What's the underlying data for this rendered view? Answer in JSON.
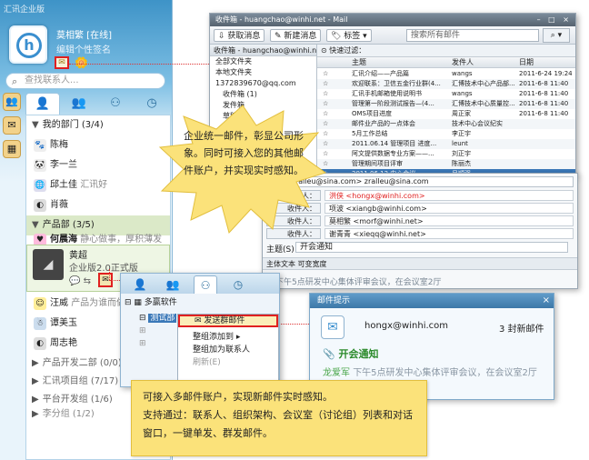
{
  "im": {
    "title": "汇讯企业版",
    "username": "莫相繁 [在线]",
    "signature": "编辑个性签名",
    "search_placeholder": "查找联系人...",
    "groups": [
      {
        "label": "我的部门 (3/4)"
      },
      {
        "label": "产品部 (3/5)"
      },
      {
        "label": "产品开发二部 (0/0)"
      },
      {
        "label": "汇讯项目组 (7/17)"
      },
      {
        "label": "平台开发组 (1/6)"
      },
      {
        "label": "李分组 (1/2)"
      }
    ],
    "contacts": [
      {
        "name": "陈梅",
        "sub": ""
      },
      {
        "name": "李一兰",
        "sub": ""
      },
      {
        "name": "邱土佳",
        "sub": "汇讯好"
      },
      {
        "name": "肖薇",
        "sub": ""
      },
      {
        "name": "何晨海",
        "sub": "静心做事，厚积薄发"
      },
      {
        "name": "汪威",
        "sub": "产品为谁而做"
      },
      {
        "name": "谭美玉",
        "sub": ""
      },
      {
        "name": "周志艳",
        "sub": ""
      }
    ],
    "selected": {
      "name": "黄超",
      "version": "企业版2.0正式版"
    }
  },
  "mail": {
    "title": "收件箱 - huangchao@winhi.net - Mail",
    "toolbar": {
      "receive": "获取消息",
      "compose": "新建消息",
      "tag": "标签"
    },
    "search_placeholder": "搜索所有邮件",
    "tree_header": "收件箱 - huangchao@winhi.net",
    "tree": [
      "全部文件夹",
      "本地文件夹",
      "1372839670@qq.com",
      "收件箱 (1)",
      "发件箱",
      "草稿"
    ],
    "filter": "快速过滤：",
    "cols": {
      "subject": "主题",
      "from": "发件人",
      "date": "日期"
    },
    "rows": [
      {
        "subject": "汇讯介绍——产品篇",
        "from": "wangs",
        "date": "2011-6-24 19:24"
      },
      {
        "subject": "欢迎联系：卫信五金行业群(4...",
        "from": "汇博技术中心产品部...",
        "date": "2011-6-8 11:40"
      },
      {
        "subject": "汇讯手机邮箱使用说明书",
        "from": "wangs",
        "date": "2011-6-8 11:40"
      },
      {
        "subject": "管理第一阶段测试报告—(4...",
        "from": "汇博技术中心质量控...",
        "date": "2011-6-8 11:40"
      },
      {
        "subject": "OMS项目进度",
        "from": "周正家",
        "date": "2011-6-8 11:40"
      },
      {
        "subject": "邮件业产品的一点体会",
        "from": "技术中心会议纪实",
        "date": ""
      },
      {
        "subject": "5月工作总结",
        "from": "李正宇",
        "date": ""
      },
      {
        "subject": "2011.06.14 管理项目 进度...",
        "from": "leunt",
        "date": ""
      },
      {
        "subject": "阿文提供数据专业方案——...",
        "from": "刘正宇",
        "date": ""
      },
      {
        "subject": "管理期间项目评审",
        "from": "陈丽杰",
        "date": ""
      },
      {
        "subject": "2011.06.13 中心会议",
        "from": "吕顺强",
        "date": ""
      },
      {
        "subject": "汇讯中心会议纪要",
        "from": "周工",
        "date": ""
      }
    ]
  },
  "compose": {
    "from": "<zralleu@sina.com> zralleu@sina.com",
    "recipient_label": "收件人：",
    "recipients": [
      {
        "name": "洪侠",
        "addr": "<hongx@winhi.com>"
      },
      {
        "name": "项波",
        "addr": "<xiangb@winhi.com>"
      },
      {
        "name": "莫相繁",
        "addr": "<morf@winhi.net>"
      },
      {
        "name": "谢青青",
        "addr": "<xieqq@winhi.net>"
      }
    ],
    "subject_label": "主题(S)：",
    "subject": "开会通知",
    "format_bar": "主体文本   可变宽度",
    "body": "下午5点研发中心集体评审会议，在会议室2厅"
  },
  "popup": {
    "tree_root": "多赢软件",
    "tree_child": "测试部",
    "menu": [
      "发送群邮件",
      "整组添加到",
      "整组加为联系人",
      "刷新(E)"
    ]
  },
  "notify": {
    "title": "邮件提示",
    "address": "hongx@winhi.com",
    "count": "3 封新邮件",
    "subject": "开会通知",
    "from": "龙爱军",
    "preview": "下午5点研发中心集体评审会议，在会议室2厅"
  },
  "callouts": {
    "burst": "企业统一邮件，彰显公司形象。同时可接入您的其他邮件账户，并实现实时感知。",
    "bottom_line1": "可接入多邮件账户，实现新邮件实时感知。",
    "bottom_line2": "支持通过：联系人、组织架构、会议室（讨论组）列表和对话窗口，一键单发、群发邮件。"
  },
  "colors": {
    "highlight_red": "#e02020",
    "callout_yellow": "#fbe27a",
    "im_blue": "#3e93c7"
  }
}
